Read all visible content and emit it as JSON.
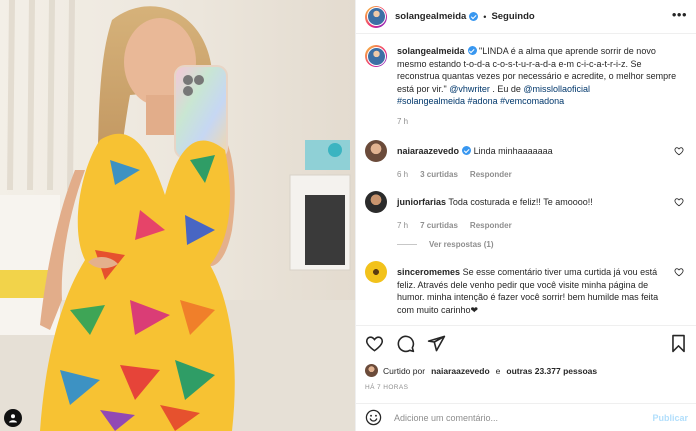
{
  "post": {
    "author": "solangealmeida",
    "follow_state": "Seguindo",
    "separator": "•",
    "caption": {
      "username": "solangealmeida",
      "text_1": " \"LINDA é a alma que aprende sorrir de novo mesmo estando t-o-d-a c-o-s-t-u-r-a-d-a e-m c-i-c-a-t-r-i-z. Se reconstrua quantas vezes por necessário e acredite, o melhor sempre está por vir.\" ",
      "mention_1": "@vhwriter",
      "text_2": " . Eu de ",
      "mention_2": "@misslollaoficial",
      "hashtags": "#solangealmeida #adona #vemcomadona",
      "age": "7 h"
    },
    "comments": [
      {
        "username": "naiaraazevedo",
        "text": "Linda minhaaaaaaa",
        "age": "6 h",
        "likes": "3 curtidas",
        "reply": "Responder"
      },
      {
        "username": "juniorfarias",
        "text": "Toda costurada e feliz!! Te amoooo!!",
        "age": "7 h",
        "likes": "7 curtidas",
        "reply": "Responder",
        "view_replies": "Ver respostas (1)"
      },
      {
        "username": "sinceromemes",
        "text": "Se esse comentário tiver uma curtida já vou está feliz. Através dele venho pedir que você visite minha página de humor. minha intenção é fazer você sorrir! bem humilde mas feita com muito carinho❤"
      }
    ],
    "liked_by": {
      "prefix": "Curtido por",
      "user": "naiaraazevedo",
      "conj": "e",
      "others": "outras 23.377 pessoas"
    },
    "timestamp": "HÁ 7 HORAS",
    "add_comment": {
      "placeholder": "Adicione um comentário...",
      "publish": "Publicar"
    }
  },
  "colors": {
    "link": "#00376b",
    "verified": "#3897f0",
    "publish_disabled": "#b2dffc",
    "muted": "#8e8e8e"
  },
  "icons": [
    "verified-badge",
    "more-options-icon",
    "heart-icon",
    "comment-icon",
    "share-icon",
    "bookmark-icon",
    "emoji-icon"
  ]
}
